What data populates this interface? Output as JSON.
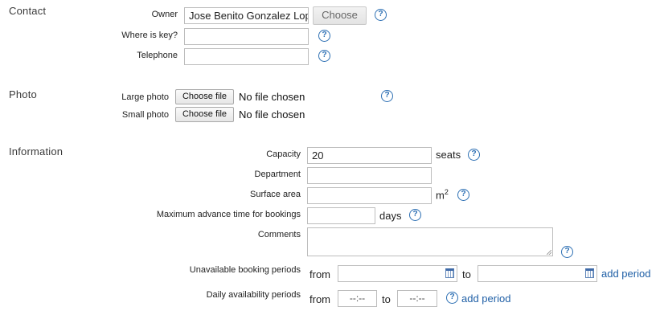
{
  "sections": {
    "contact": "Contact",
    "photo": "Photo",
    "information": "Information"
  },
  "contact": {
    "owner_label": "Owner",
    "owner_value": "Jose Benito Gonzalez Lop",
    "owner_button": "Choose",
    "key_label": "Where is key?",
    "key_value": "",
    "telephone_label": "Telephone",
    "telephone_value": ""
  },
  "photo": {
    "large_label": "Large photo",
    "small_label": "Small photo",
    "choose_file": "Choose file",
    "no_file": "No file chosen"
  },
  "information": {
    "capacity_label": "Capacity",
    "capacity_value": "20",
    "capacity_unit": "seats",
    "department_label": "Department",
    "department_value": "",
    "surface_label": "Surface area",
    "surface_value": "",
    "surface_unit_base": "m",
    "surface_unit_exp": "2",
    "advance_label": "Maximum advance time for bookings",
    "advance_value": "",
    "advance_unit": "days",
    "comments_label": "Comments",
    "comments_value": "",
    "unavailable_label": "Unavailable booking periods",
    "daily_label": "Daily availability periods",
    "from_word": "from",
    "to_word": "to",
    "add_period": "add period",
    "time_placeholder": "--:--"
  },
  "help_symbol": "?",
  "icons": {
    "help": "help-icon",
    "calendar": "calendar-icon"
  },
  "colors": {
    "link": "#1f5fa6",
    "help": "#2c6fb3"
  }
}
